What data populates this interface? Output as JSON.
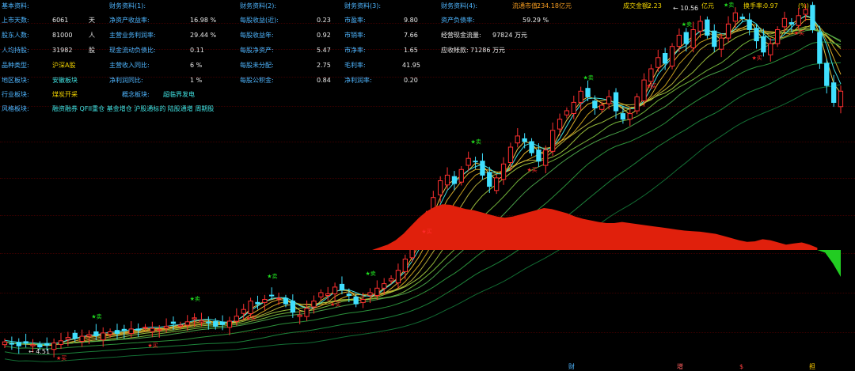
{
  "panel": {
    "basic": {
      "title": "基本资料:",
      "rows": [
        {
          "label": "上市天数:",
          "value": "6061",
          "unit": "天"
        },
        {
          "label": "股东人数:",
          "value": "81000",
          "unit": "人"
        },
        {
          "label": "人均持股:",
          "value": "31982",
          "unit": "股"
        },
        {
          "label": "品种类型:",
          "value": "沪深A股",
          "unit": ""
        },
        {
          "label": "地区板块:",
          "value": "安徽板块",
          "unit": ""
        },
        {
          "label": "行业板块:",
          "value": "煤炭开采",
          "unit": ""
        }
      ],
      "concept_label": "概念板块:",
      "concept_value": "超临界发电",
      "style_label": "风格板块:",
      "style_value": "融资融券 QFII重仓 基金增仓 沪股通标的 陆股通增 周期股"
    },
    "finance1": {
      "title": "财务资料(1):",
      "rows": [
        {
          "label": "净资产收益率:",
          "value": "16.98 %"
        },
        {
          "label": "主营业务利润率:",
          "value": "29.44 %"
        },
        {
          "label": "现金流动负债比:",
          "value": "0.11"
        },
        {
          "label": "主营收入同比:",
          "value": "6 %"
        },
        {
          "label": "净利润同比:",
          "value": "1 %"
        }
      ]
    },
    "finance2": {
      "title": "财务资料(2):",
      "rows": [
        {
          "label": "每股收益(近):",
          "value": "0.23"
        },
        {
          "label": "每股收益年:",
          "value": "0.92"
        },
        {
          "label": "每股净资产:",
          "value": "5.47"
        },
        {
          "label": "每股未分配:",
          "value": "2.75"
        },
        {
          "label": "每股公积金:",
          "value": "0.84"
        }
      ]
    },
    "finance3": {
      "title": "财务资料(3):",
      "rows": [
        {
          "label": "市盈率:",
          "value": "9.80"
        },
        {
          "label": "市销率:",
          "value": "7.66"
        },
        {
          "label": "市净率:",
          "value": "1.65"
        },
        {
          "label": "毛利率:",
          "value": "41.95"
        },
        {
          "label": "净利润率:",
          "value": "0.20"
        }
      ]
    },
    "finance4": {
      "title": "财务资料(4):",
      "rows": [
        {
          "label": "资产负债率:",
          "value": "59.29 %"
        },
        {
          "label": "经营现金流量:",
          "value": "97824 万元"
        },
        {
          "label": "应收帐款:",
          "value": "71286 万元"
        }
      ]
    },
    "header": {
      "market_cap_label": "流通市值:",
      "market_cap_value": "234.18亿元",
      "turnover_amount_label": "成交金额:",
      "turnover_amount_value": "2.23",
      "turnover_amount_unit": "亿元",
      "turnover_rate_label": "换手率:",
      "turnover_rate_value": "0.97",
      "turnover_rate_unit": "(%)"
    }
  },
  "chart_annotations": {
    "high_label": "10.56",
    "low_label": "4.51",
    "buy_label": "★卖",
    "sell_label": "★买"
  },
  "bottom_tabs": [
    {
      "label": "财",
      "color": "#4fb6ff"
    },
    {
      "label": "增",
      "color": "#ff6060"
    },
    {
      "label": "$",
      "color": "#ff4040"
    },
    {
      "label": "担",
      "color": "#ffcc00"
    }
  ],
  "chart_data": {
    "type": "candlestick",
    "price_range": [
      4.51,
      10.56
    ],
    "closes": [
      4.62,
      4.58,
      4.55,
      4.6,
      4.57,
      4.53,
      4.56,
      4.6,
      4.64,
      4.7,
      4.68,
      4.72,
      4.75,
      4.73,
      4.78,
      4.8,
      4.77,
      4.82,
      4.85,
      4.83,
      4.88,
      4.86,
      4.84,
      4.9,
      4.95,
      4.92,
      4.98,
      5.05,
      5.0,
      4.96,
      4.9,
      4.93,
      4.99,
      5.08,
      5.2,
      5.35,
      5.3,
      5.38,
      5.45,
      5.4,
      5.3,
      5.15,
      5.1,
      5.22,
      5.35,
      5.5,
      5.48,
      5.6,
      5.55,
      5.45,
      5.3,
      5.38,
      5.5,
      5.58,
      5.66,
      5.75,
      5.9,
      6.1,
      6.4,
      6.6,
      6.9,
      7.2,
      7.5,
      7.6,
      7.45,
      7.7,
      7.9,
      7.85,
      7.6,
      7.4,
      7.55,
      7.8,
      8.1,
      8.3,
      8.2,
      8.0,
      7.85,
      8.05,
      8.4,
      8.6,
      8.75,
      8.9,
      9.1,
      9.0,
      8.8,
      8.85,
      9.0,
      8.75,
      8.6,
      8.7,
      9.0,
      9.3,
      9.5,
      9.7,
      9.6,
      9.9,
      10.1,
      9.95,
      10.2,
      10.35,
      10.1,
      9.9,
      10.05,
      10.3,
      10.5,
      10.4,
      10.2,
      10.0,
      9.8,
      9.95,
      10.2,
      10.4,
      10.3,
      10.45,
      10.56,
      10.2,
      9.6,
      9.2,
      8.9,
      9.1
    ],
    "indicator": {
      "name": "histogram",
      "values": [
        0,
        0.05,
        0.1,
        0.18,
        0.3,
        0.45,
        0.6,
        0.72,
        0.8,
        0.85,
        0.84,
        0.8,
        0.76,
        0.74,
        0.7,
        0.66,
        0.62,
        0.6,
        0.62,
        0.66,
        0.7,
        0.74,
        0.78,
        0.76,
        0.72,
        0.68,
        0.62,
        0.58,
        0.55,
        0.52,
        0.5,
        0.5,
        0.52,
        0.5,
        0.48,
        0.46,
        0.44,
        0.42,
        0.4,
        0.38,
        0.36,
        0.35,
        0.34,
        0.32,
        0.3,
        0.26,
        0.22,
        0.18,
        0.15,
        0.16,
        0.2,
        0.18,
        0.14,
        0.1,
        0.12,
        0.14,
        0.1,
        0.04,
        -0.05,
        -0.25,
        -0.5
      ]
    }
  }
}
